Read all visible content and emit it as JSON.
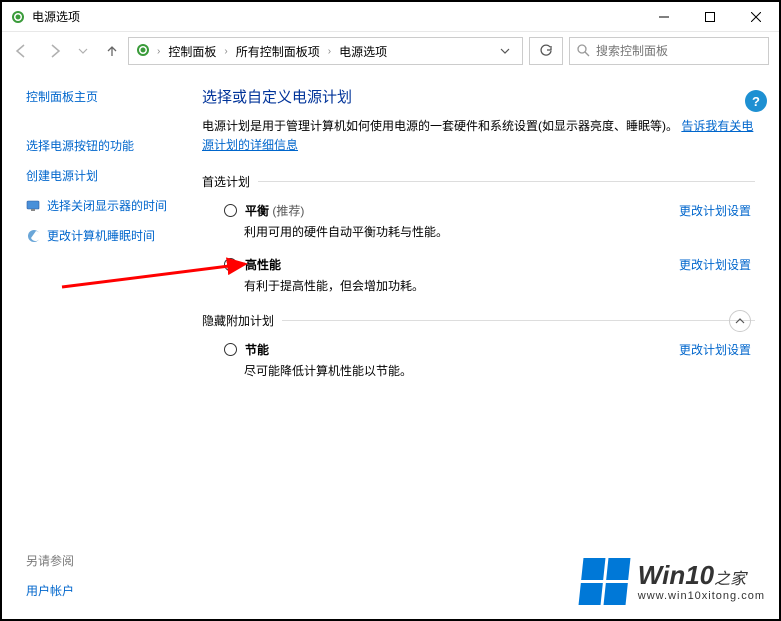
{
  "window": {
    "title": "电源选项"
  },
  "nav": {
    "breadcrumb": [
      "控制面板",
      "所有控制面板项",
      "电源选项"
    ],
    "search_placeholder": "搜索控制面板"
  },
  "sidebar": {
    "home": "控制面板主页",
    "links": [
      "选择电源按钮的功能",
      "创建电源计划",
      "选择关闭显示器的时间",
      "更改计算机睡眠时间"
    ],
    "see_also_header": "另请参阅",
    "see_also_links": [
      "用户帐户"
    ]
  },
  "main": {
    "heading": "选择或自定义电源计划",
    "description": "电源计划是用于管理计算机如何使用电源的一套硬件和系统设置(如显示器亮度、睡眠等)。",
    "description_link": "告诉我有关电源计划的详细信息",
    "preferred_section": "首选计划",
    "hidden_section": "隐藏附加计划",
    "plans": [
      {
        "name": "平衡",
        "sub": "(推荐)",
        "desc": "利用可用的硬件自动平衡功耗与性能。",
        "change_link": "更改计划设置",
        "selected": false
      },
      {
        "name": "高性能",
        "sub": "",
        "desc": "有利于提高性能，但会增加功耗。",
        "change_link": "更改计划设置",
        "selected": true
      }
    ],
    "hidden_plans": [
      {
        "name": "节能",
        "sub": "",
        "desc": "尽可能降低计算机性能以节能。",
        "change_link": "更改计划设置",
        "selected": false
      }
    ]
  },
  "watermark": {
    "brand_main": "Win10",
    "brand_suffix": "之家",
    "url": "www.win10xitong.com"
  }
}
